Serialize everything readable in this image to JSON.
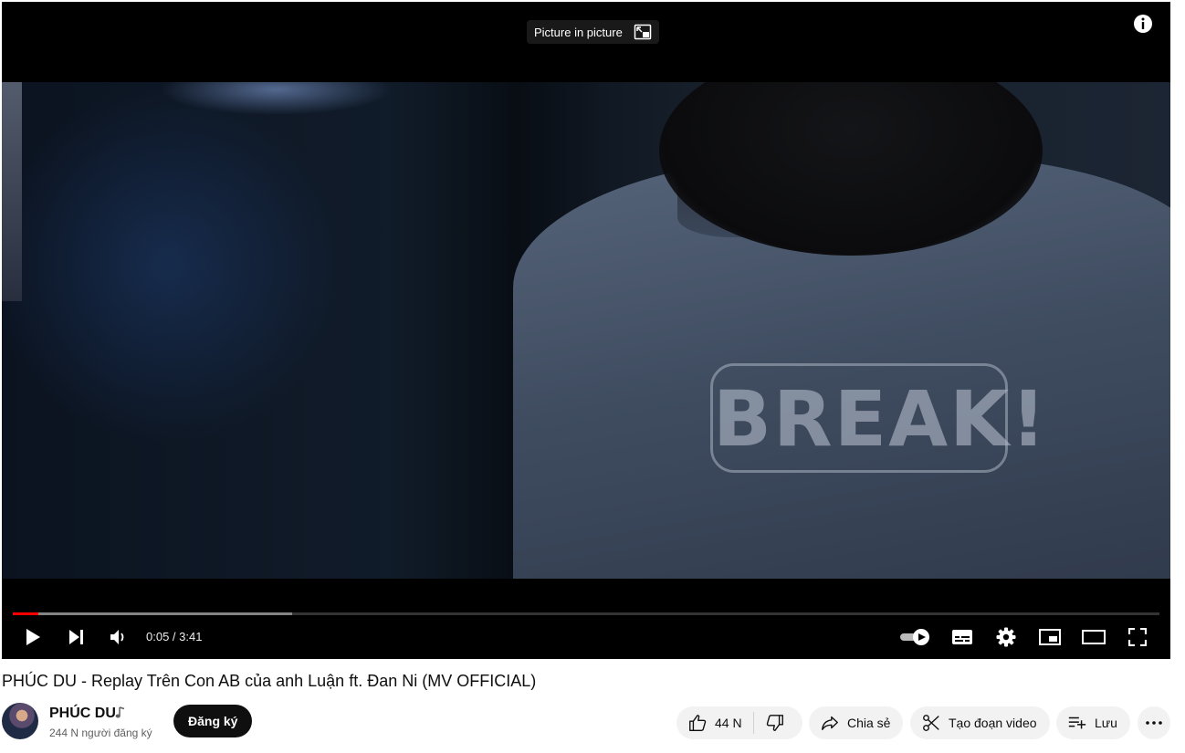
{
  "player": {
    "pip_tooltip": "Picture in picture",
    "current_time": "0:05",
    "duration": "3:41",
    "time_display": "0:05 / 3:41",
    "progress_played_fraction": 0.0226,
    "progress_buffered_fraction": 0.2435,
    "frame_text": "BREAK!",
    "autoplay": true,
    "icons": [
      "info-icon",
      "picture-in-picture-icon",
      "play-icon",
      "next-icon",
      "volume-icon",
      "autoplay-toggle-icon",
      "subtitles-icon",
      "settings-icon",
      "miniplayer-icon",
      "theater-mode-icon",
      "fullscreen-icon"
    ]
  },
  "video": {
    "title": "PHÚC DU - Replay Trên Con AB của anh Luận ft. Đan Ni (MV OFFICIAL)"
  },
  "channel": {
    "name": "PHÚC DU",
    "subscribers": "244 N người đăng ký",
    "subscribe_label": "Đăng ký"
  },
  "actions": {
    "likes": "44 N",
    "share_label": "Chia sẻ",
    "clip_label": "Tạo đoạn video",
    "save_label": "Lưu"
  },
  "colors": {
    "progress_played": "#ff0000",
    "pill_bg": "#f2f2f2",
    "subscribe_bg": "#0f0f0f"
  }
}
